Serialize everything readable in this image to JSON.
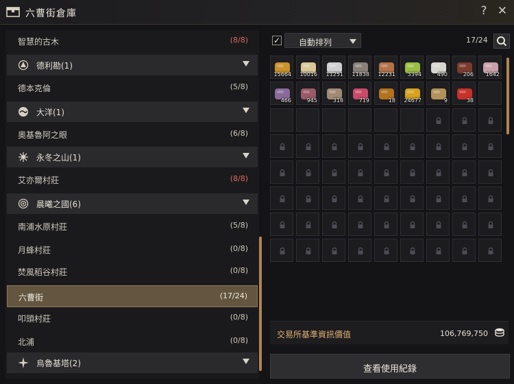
{
  "window": {
    "title": "六曹街倉庫",
    "help_label": "?",
    "close_label": "✕"
  },
  "colors": {
    "accent_gold": "#b08456",
    "full_count_red": "#d86a5c",
    "selected_row": "#63553f",
    "value_label": "#e0b072"
  },
  "town_list": [
    {
      "type": "town",
      "name": "智慧的古木",
      "count": "(8/8)",
      "full": true
    },
    {
      "type": "region",
      "name": "德利勘(1)",
      "icon": "tree-icon"
    },
    {
      "type": "town",
      "name": "德本克倫",
      "count": "(5/8)",
      "full": false
    },
    {
      "type": "region",
      "name": "大洋(1)",
      "icon": "ocean-icon"
    },
    {
      "type": "town",
      "name": "奧基魯阿之眼",
      "count": "(6/8)",
      "full": false
    },
    {
      "type": "region",
      "name": "永冬之山(1)",
      "icon": "snow-mountain-icon"
    },
    {
      "type": "town",
      "name": "艾亦爾村莊",
      "count": "(8/8)",
      "full": true
    },
    {
      "type": "region",
      "name": "晨曦之國(6)",
      "icon": "sun-icon"
    },
    {
      "type": "town",
      "name": "南浦水原村莊",
      "count": "(5/8)",
      "full": false
    },
    {
      "type": "town",
      "name": "月蜂村莊",
      "count": "(0/8)",
      "full": false
    },
    {
      "type": "town",
      "name": "焚風稻谷村莊",
      "count": "(0/8)",
      "full": false
    },
    {
      "type": "town",
      "name": "六曹街",
      "count": "(17/24)",
      "full": false,
      "selected": true
    },
    {
      "type": "town",
      "name": "叩頭村莊",
      "count": "(0/8)",
      "full": false
    },
    {
      "type": "town",
      "name": "北浦",
      "count": "(0/8)",
      "full": false
    },
    {
      "type": "region",
      "name": "烏魯基塔(2)",
      "icon": "star-icon"
    }
  ],
  "toolbar": {
    "auto_sort_checked": true,
    "auto_sort_label": "自動排列",
    "slot_count": "17/24"
  },
  "items": [
    {
      "icon": "gold-bar-icon",
      "qty": "15664",
      "color": "#c8922a"
    },
    {
      "icon": "silver-plank-icon",
      "qty": "10016",
      "color": "#d8c79a"
    },
    {
      "icon": "salt-pile-icon",
      "qty": "11251",
      "color": "#cfcfd2"
    },
    {
      "icon": "ore-pile-icon",
      "qty": "11838",
      "color": "#8a8078"
    },
    {
      "icon": "brick-icon",
      "qty": "12231",
      "color": "#b2724a"
    },
    {
      "icon": "wheat-icon",
      "qty": "3394",
      "color": "#9bbf44"
    },
    {
      "icon": "horn-icon",
      "qty": "490",
      "color": "#d8d6d0"
    },
    {
      "icon": "meat-icon",
      "qty": "206",
      "color": "#7a3c2c"
    },
    {
      "icon": "garlic-icon",
      "qty": "1642",
      "color": "#c7a2a8"
    },
    {
      "icon": "purple-stone-icon",
      "qty": "466",
      "color": "#8a6a9a"
    },
    {
      "icon": "red-stone-icon",
      "qty": "945",
      "color": "#9a5a6a"
    },
    {
      "icon": "rock-icon",
      "qty": "318",
      "color": "#a08a74"
    },
    {
      "icon": "gem-cluster-icon",
      "qty": "719",
      "color": "#c84a6a"
    },
    {
      "icon": "chest-icon",
      "qty": "18",
      "color": "#b2721e"
    },
    {
      "icon": "fortune-box-icon",
      "qty": "24677",
      "color": "#d6a220"
    },
    {
      "icon": "potion-jar-icon",
      "qty": "9",
      "color": "#b2925a"
    },
    {
      "icon": "gift-box-icon",
      "qty": "38",
      "color": "#c8302a"
    }
  ],
  "empty_unlocked_slots": 7,
  "locked_slots": 48,
  "value": {
    "label": "交易所基準資訊價值",
    "amount": "106,769,750",
    "icon": "coin-stack-icon"
  },
  "history_button": {
    "label": "查看使用紀錄"
  }
}
